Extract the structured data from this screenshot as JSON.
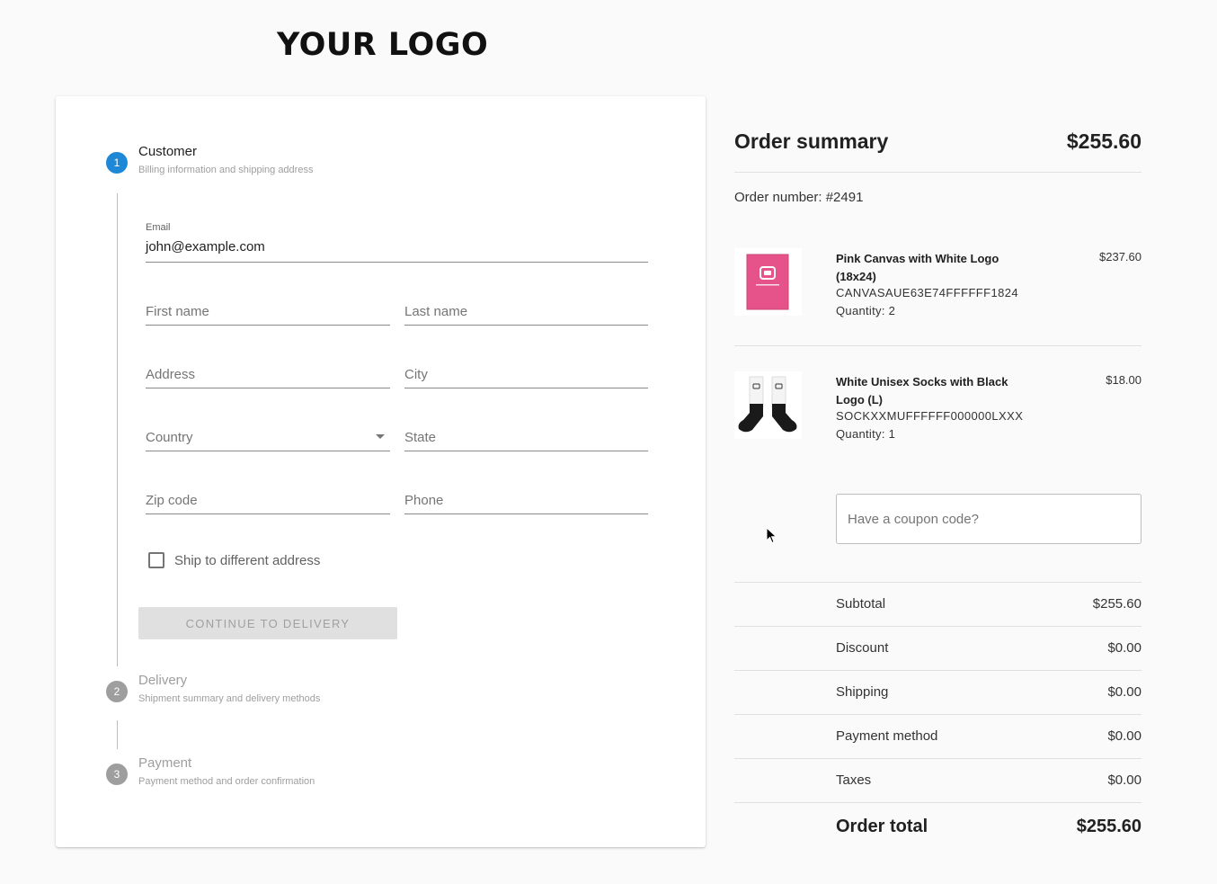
{
  "logo": {
    "text": "YOUR LOGO"
  },
  "steps": [
    {
      "number": "1",
      "title": "Customer",
      "subtitle": "Billing information and shipping address",
      "state": "active"
    },
    {
      "number": "2",
      "title": "Delivery",
      "subtitle": "Shipment summary and delivery methods",
      "state": "inactive"
    },
    {
      "number": "3",
      "title": "Payment",
      "subtitle": "Payment method and order confirmation",
      "state": "inactive"
    }
  ],
  "form": {
    "email": {
      "label": "Email",
      "value": "john@example.com"
    },
    "first_name": {
      "placeholder": "First name"
    },
    "last_name": {
      "placeholder": "Last name"
    },
    "address": {
      "placeholder": "Address"
    },
    "city": {
      "placeholder": "City"
    },
    "country": {
      "placeholder": "Country"
    },
    "state": {
      "placeholder": "State"
    },
    "zip": {
      "placeholder": "Zip code"
    },
    "phone": {
      "placeholder": "Phone"
    },
    "ship_different": {
      "label": "Ship to different address",
      "checked": false
    },
    "continue_button": "CONTINUE TO DELIVERY"
  },
  "summary": {
    "title": "Order summary",
    "total": "$255.60",
    "order_number": "Order number: #2491",
    "items": [
      {
        "name": "Pink Canvas with White Logo (18x24)",
        "sku": "CANVASAUE63E74FFFFFF1824",
        "quantity": "Quantity: 2",
        "price": "$237.60",
        "thumb_icon": "pink-canvas-thumbnail"
      },
      {
        "name": "White Unisex Socks with Black Logo (L)",
        "sku": "SOCKXXMUFFFFFF000000LXXX",
        "quantity": "Quantity: 1",
        "price": "$18.00",
        "thumb_icon": "socks-thumbnail"
      }
    ],
    "coupon_placeholder": "Have a coupon code?",
    "rows": [
      {
        "label": "Subtotal",
        "value": "$255.60"
      },
      {
        "label": "Discount",
        "value": "$0.00"
      },
      {
        "label": "Shipping",
        "value": "$0.00"
      },
      {
        "label": "Payment method",
        "value": "$0.00"
      },
      {
        "label": "Taxes",
        "value": "$0.00"
      }
    ],
    "order_total_label": "Order total",
    "order_total_value": "$255.60"
  },
  "colors": {
    "accent": "#1e88d7",
    "canvas_pink": "#e6538a"
  }
}
